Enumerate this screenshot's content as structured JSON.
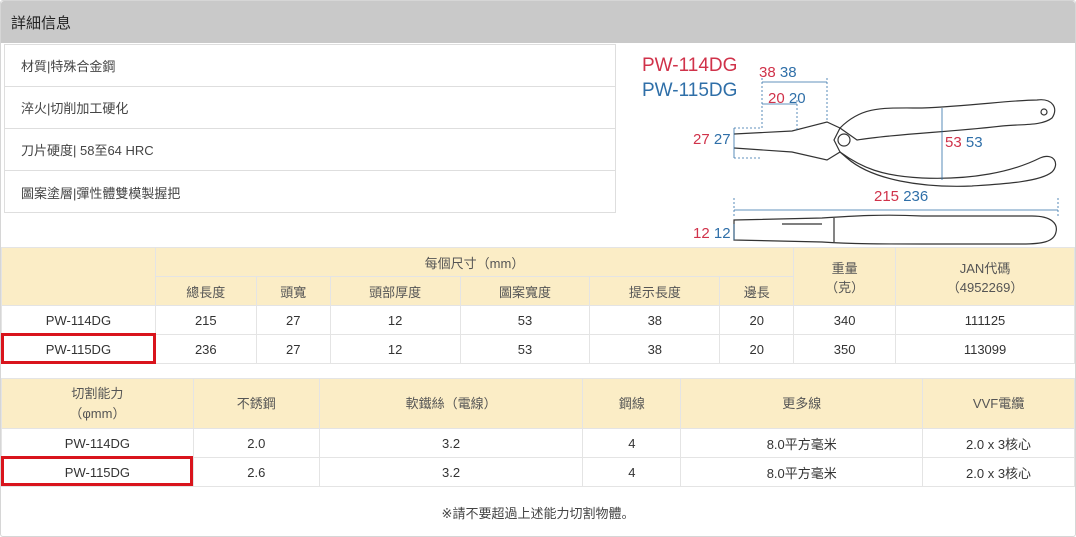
{
  "header": {
    "title": "詳細信息"
  },
  "specs": [
    "材質|特殊合金鋼",
    "淬火|切削加工硬化",
    "刀片硬度| 58至64 HRC",
    "圖案塗層|彈性體雙模製握把"
  ],
  "diagram": {
    "model_a": "PW-114DG",
    "model_b": "PW-115DG",
    "dims": {
      "tip_length": {
        "a": "38",
        "b": "38"
      },
      "edge_length": {
        "a": "20",
        "b": "20"
      },
      "head_width": {
        "a": "27",
        "b": "27"
      },
      "grip_width": {
        "a": "53",
        "b": "53"
      },
      "total_length": {
        "a": "215",
        "b": "236"
      },
      "head_thickness": {
        "a": "12",
        "b": "12"
      }
    },
    "colors": {
      "model_a": "#d0324a",
      "model_b": "#2f6fa8"
    }
  },
  "size_table": {
    "group_header": "每個尺寸（mm）",
    "weight_header": "重量\n（克）",
    "jan_header": "JAN代碼\n（4952269）",
    "sub_headers": [
      "總長度",
      "頭寬",
      "頭部厚度",
      "圖案寬度",
      "提示長度",
      "邊長"
    ],
    "rows": [
      [
        "PW-114DG",
        "215",
        "27",
        "12",
        "53",
        "38",
        "20",
        "340",
        "111125"
      ],
      [
        "PW-115DG",
        "236",
        "27",
        "12",
        "53",
        "38",
        "20",
        "350",
        "113099"
      ]
    ]
  },
  "cut_table": {
    "headers": [
      "切割能力\n（φmm）",
      "不銹鋼",
      "軟鐵絲（電線）",
      "鋼線",
      "更多線",
      "VVF電纜"
    ],
    "rows": [
      [
        "PW-114DG",
        "2.0",
        "3.2",
        "4",
        "8.0平方毫米",
        "2.0 x 3核心"
      ],
      [
        "PW-115DG",
        "2.6",
        "3.2",
        "4",
        "8.0平方毫米",
        "2.0 x 3核心"
      ]
    ]
  },
  "note": "※請不要超過上述能力切割物體。",
  "highlight_color": "#d9141c"
}
